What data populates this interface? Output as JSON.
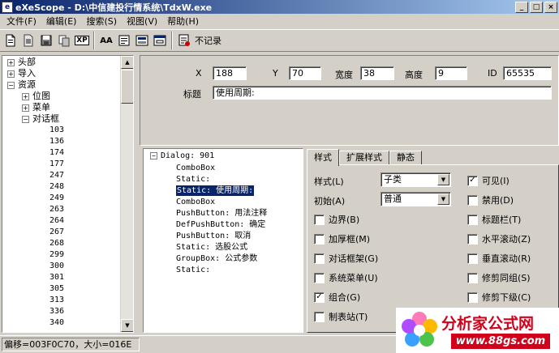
{
  "window": {
    "title": "eXeScope - D:\\中信建投行情系统\\TdxW.exe",
    "app_icon_glyph": "e",
    "buttons": {
      "minimize": "_",
      "maximize": "□",
      "close": "×"
    }
  },
  "menu": [
    "文件(F)",
    "编辑(E)",
    "搜索(S)",
    "视图(V)",
    "帮助(H)"
  ],
  "toolbar": {
    "icons": [
      "new-file-icon",
      "open-file-icon",
      "save-icon",
      "copy-icon",
      "xp-icon",
      "font-icon",
      "export-icon",
      "image-icon",
      "dialog-icon",
      "record-icon"
    ],
    "xp_label": "XP",
    "font_label": "AA",
    "record_label": "不记录"
  },
  "left_tree": {
    "nodes": [
      {
        "label": "头部",
        "toggle": "+"
      },
      {
        "label": "导入",
        "toggle": "+"
      },
      {
        "label": "资源",
        "toggle": "−"
      },
      {
        "label": "位图",
        "toggle": "+"
      },
      {
        "label": "菜单",
        "toggle": "+"
      },
      {
        "label": "对话框",
        "toggle": "−"
      }
    ],
    "leaves": [
      "103",
      "136",
      "174",
      "177",
      "247",
      "248",
      "249",
      "263",
      "264",
      "267",
      "268",
      "299",
      "300",
      "301",
      "305",
      "313",
      "336",
      "340"
    ]
  },
  "props": {
    "x_label": "X",
    "x_value": "188",
    "y_label": "Y",
    "y_value": "70",
    "width_label": "宽度",
    "width_value": "38",
    "height_label": "高度",
    "height_value": "9",
    "id_label": "ID",
    "id_value": "65535",
    "title_label": "标题",
    "title_value": "使用周期:"
  },
  "dialog_tree": {
    "root_toggle": "−",
    "root": "Dialog: 901",
    "items": [
      "ComboBox",
      "Static:",
      "Static: 使用周期:",
      "ComboBox",
      "PushButton: 用法注释",
      "DefPushButton: 确定",
      "PushButton: 取消",
      "Static: 选股公式",
      "GroupBox: 公式参数",
      "Static:"
    ],
    "selected_index": 2
  },
  "tabs": [
    "样式",
    "扩展样式",
    "静态"
  ],
  "style_page": {
    "style_label": "样式(L)",
    "style_value": "子类",
    "init_label": "初始(A)",
    "init_value": "普通",
    "dropdown_glyph": "▼",
    "checkboxes_left": [
      {
        "label": "边界(B)",
        "checked": false
      },
      {
        "label": "加厚框(M)",
        "checked": false
      },
      {
        "label": "对话框架(G)",
        "checked": false
      },
      {
        "label": "系统菜单(U)",
        "checked": false
      },
      {
        "label": "组合(G)",
        "checked": true
      },
      {
        "label": "制表站(T)",
        "checked": false
      }
    ],
    "checkboxes_right": [
      {
        "label": "可见(I)",
        "checked": true
      },
      {
        "label": "禁用(D)",
        "checked": false
      },
      {
        "label": "标题栏(T)",
        "checked": false
      },
      {
        "label": "水平滚动(Z)",
        "checked": false
      },
      {
        "label": "垂直滚动(R)",
        "checked": false
      },
      {
        "label": "修剪同组(S)",
        "checked": false
      },
      {
        "label": "修剪下级(C)",
        "checked": false
      }
    ],
    "check_glyph": "✓"
  },
  "status": {
    "text": "偏移=003F0C70，大小=016E"
  },
  "scrollbar": {
    "up": "▲",
    "down": "▼"
  },
  "watermark": {
    "title": "分析家公式网",
    "url": "www.88gs.com"
  }
}
